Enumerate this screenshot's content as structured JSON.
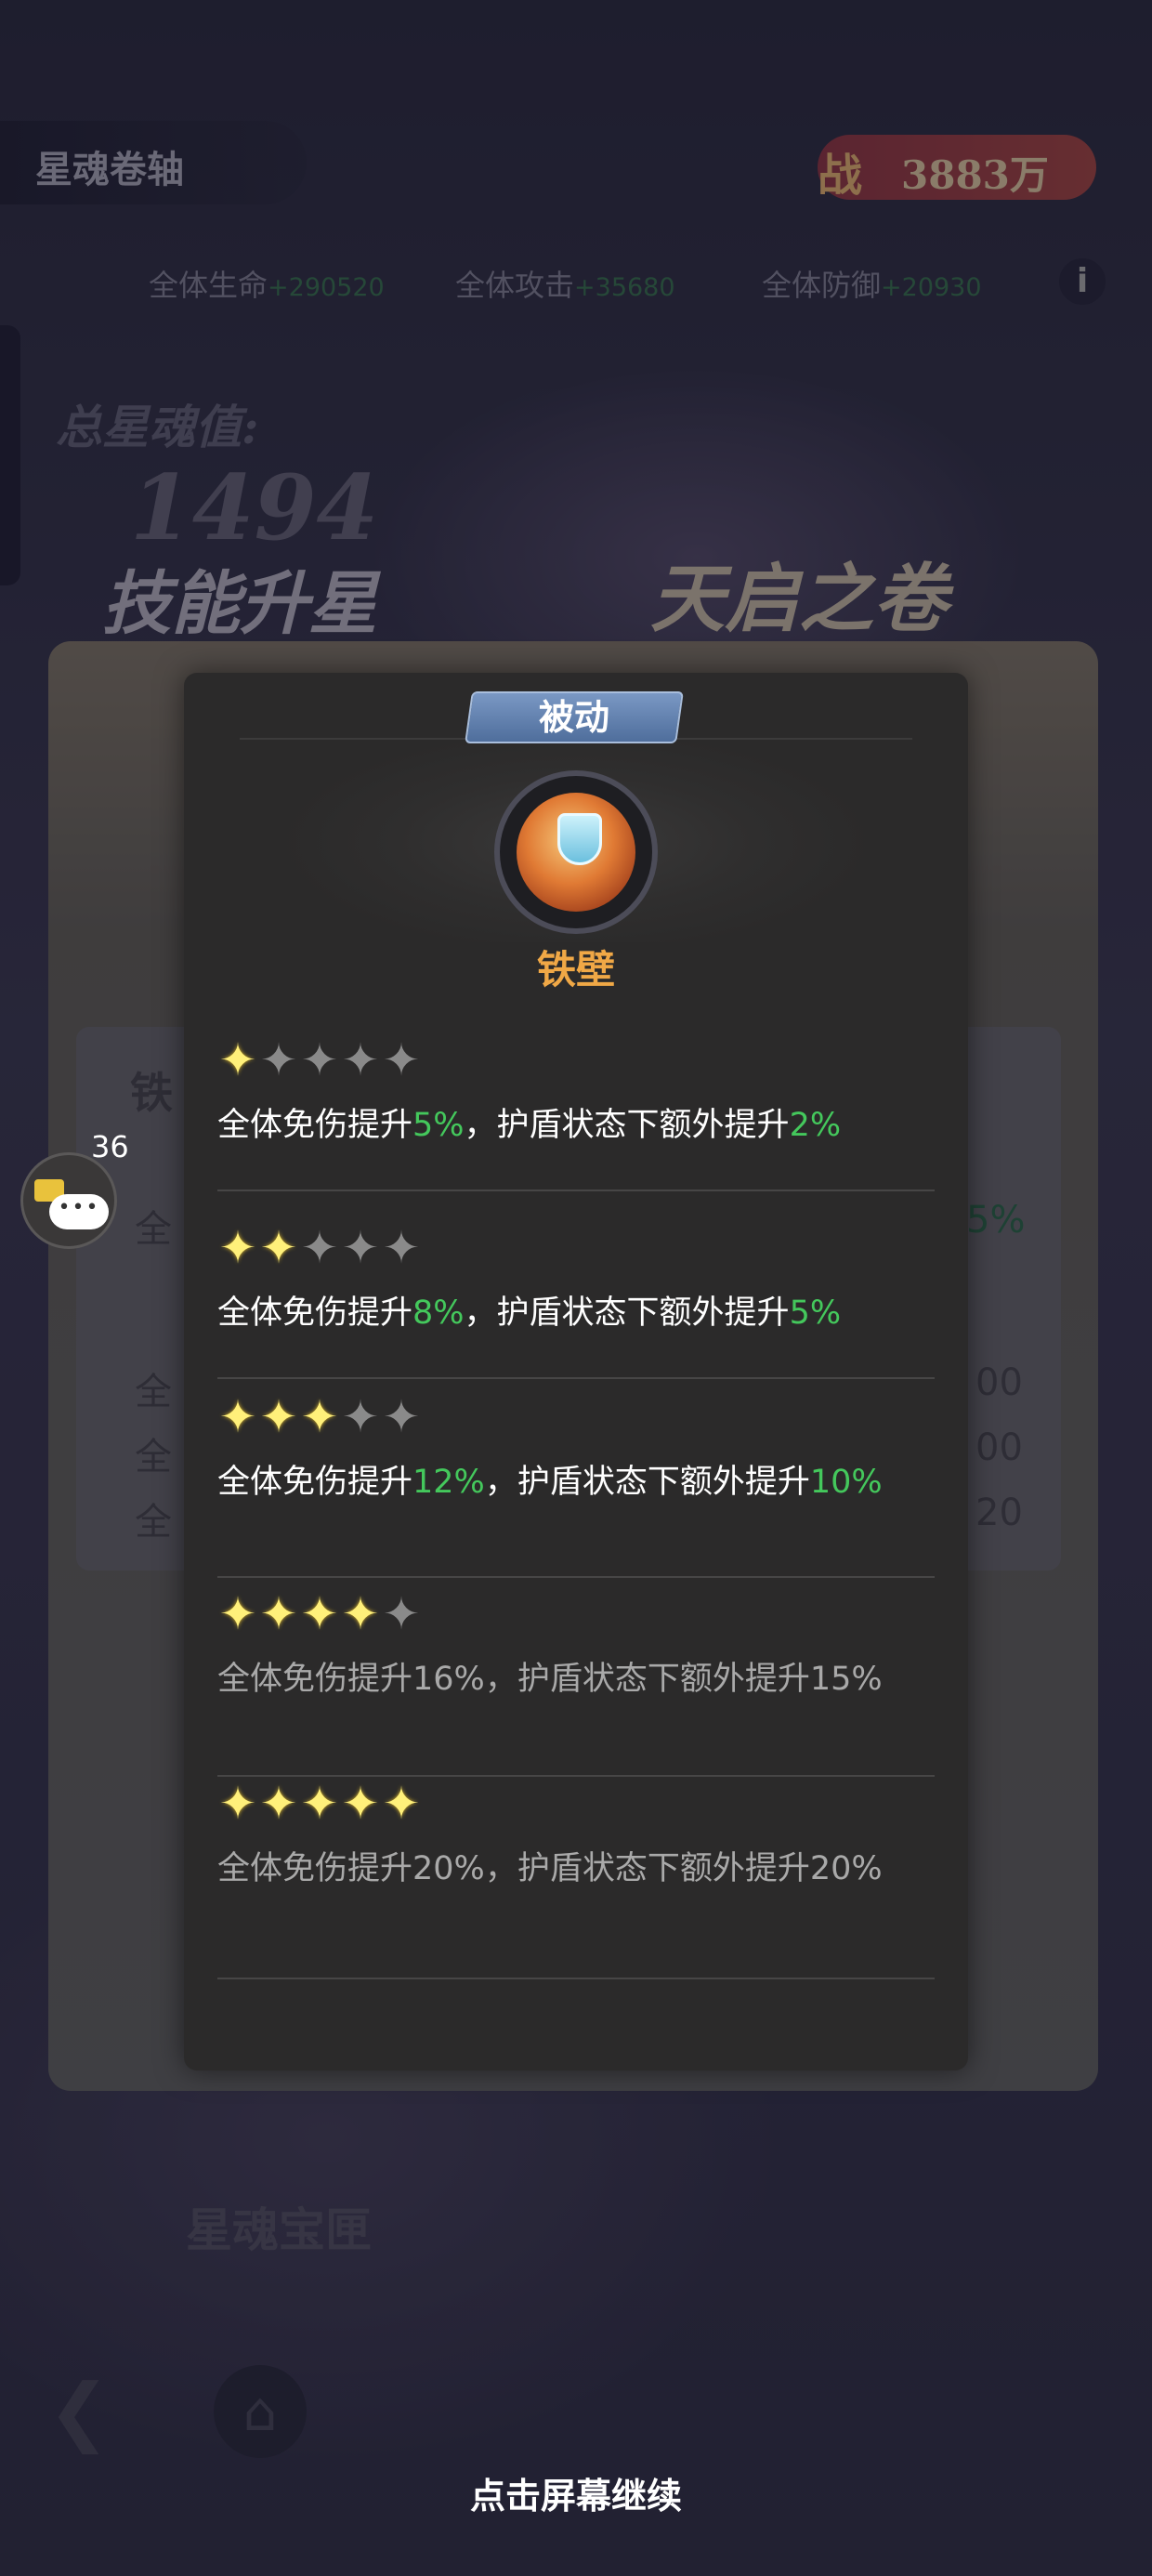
{
  "background": {
    "title": "星魂卷轴",
    "power": {
      "label": "战",
      "value": "3883万"
    },
    "stats": [
      {
        "label": "全体生命",
        "value": "+290520"
      },
      {
        "label": "全体攻击",
        "value": "+35680"
      },
      {
        "label": "全体防御",
        "value": "+20930"
      }
    ],
    "info_icon": "i",
    "total_star_soul_label": "总星魂值:",
    "total_star_soul_value": "1494",
    "skill_upgrade_label": "技能升星",
    "apocalypse_label": "天启之卷",
    "treasure_label": "星魂宝匣",
    "card_title_fragment": "铁",
    "card_rows": [
      {
        "left": "全",
        "right": "5%"
      },
      {
        "left": "全",
        "right": "00"
      },
      {
        "left": "全",
        "right": "00"
      },
      {
        "left": "全",
        "right": "20"
      }
    ],
    "back_icon": "back-arrow-icon",
    "home_icon": "home-icon"
  },
  "chat": {
    "unread_count": "36"
  },
  "popup": {
    "type_tag": "被动",
    "skill_name": "铁壁",
    "levels": [
      {
        "stars": 1,
        "parts": [
          "全体免伤提升",
          "5%",
          "，护盾状态下额外提升",
          "2%"
        ],
        "unlocked": true
      },
      {
        "stars": 2,
        "parts": [
          "全体免伤提升",
          "8%",
          "，护盾状态下额外提升",
          "5%"
        ],
        "unlocked": true
      },
      {
        "stars": 3,
        "parts": [
          "全体免伤提升",
          "12%",
          "，护盾状态下额外提升",
          "10%"
        ],
        "unlocked": true
      },
      {
        "stars": 4,
        "parts": [
          "全体免伤提升",
          "16%",
          "，护盾状态下额外提升",
          "15%"
        ],
        "unlocked": false
      },
      {
        "stars": 5,
        "parts": [
          "全体免伤提升",
          "20%",
          "，护盾状态下额外提升",
          "20%"
        ],
        "unlocked": false
      }
    ],
    "max_stars": 5
  },
  "continue_hint": "点击屏幕继续",
  "colors": {
    "highlight_green": "#44c85c",
    "skill_name_orange": "#f0a846",
    "star_on": "#fff07a",
    "star_off": "#8a8a8a",
    "tag_blue": "#5b7aa8"
  }
}
